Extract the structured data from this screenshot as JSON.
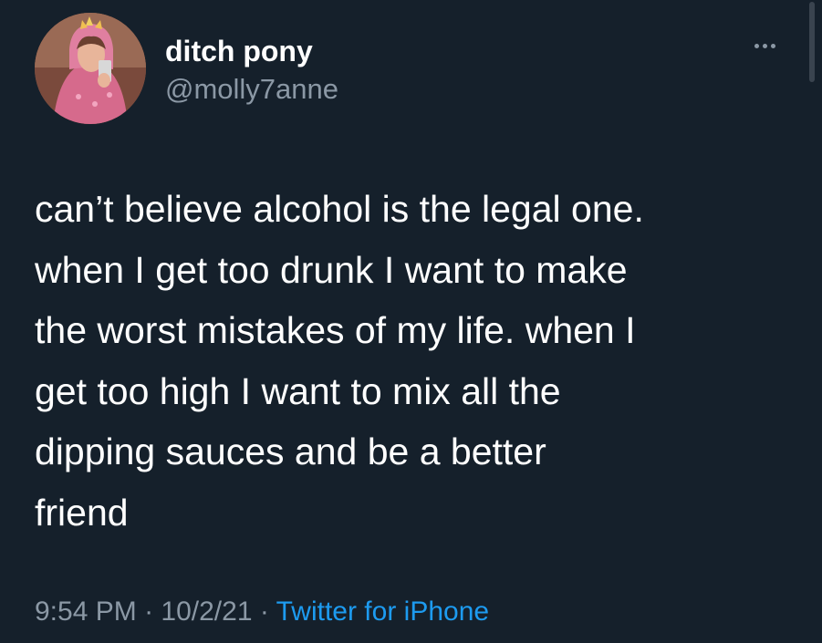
{
  "author": {
    "display_name": "ditch pony",
    "handle": "@molly7anne"
  },
  "tweet": {
    "text": "can’t believe alcohol is the legal one.\nwhen I get too drunk I want to make\nthe worst mistakes of my life. when I\nget too high I want to mix all the\ndipping sauces and be a better\nfriend"
  },
  "meta": {
    "time": "9:54 PM",
    "separator": " · ",
    "date": "10/2/21",
    "source": "Twitter for iPhone"
  },
  "icons": {
    "more": "more-dots-icon"
  },
  "colors": {
    "background": "#15202b",
    "text": "#ffffff",
    "secondary_text": "#8b98a5",
    "link": "#1d9bf0"
  }
}
